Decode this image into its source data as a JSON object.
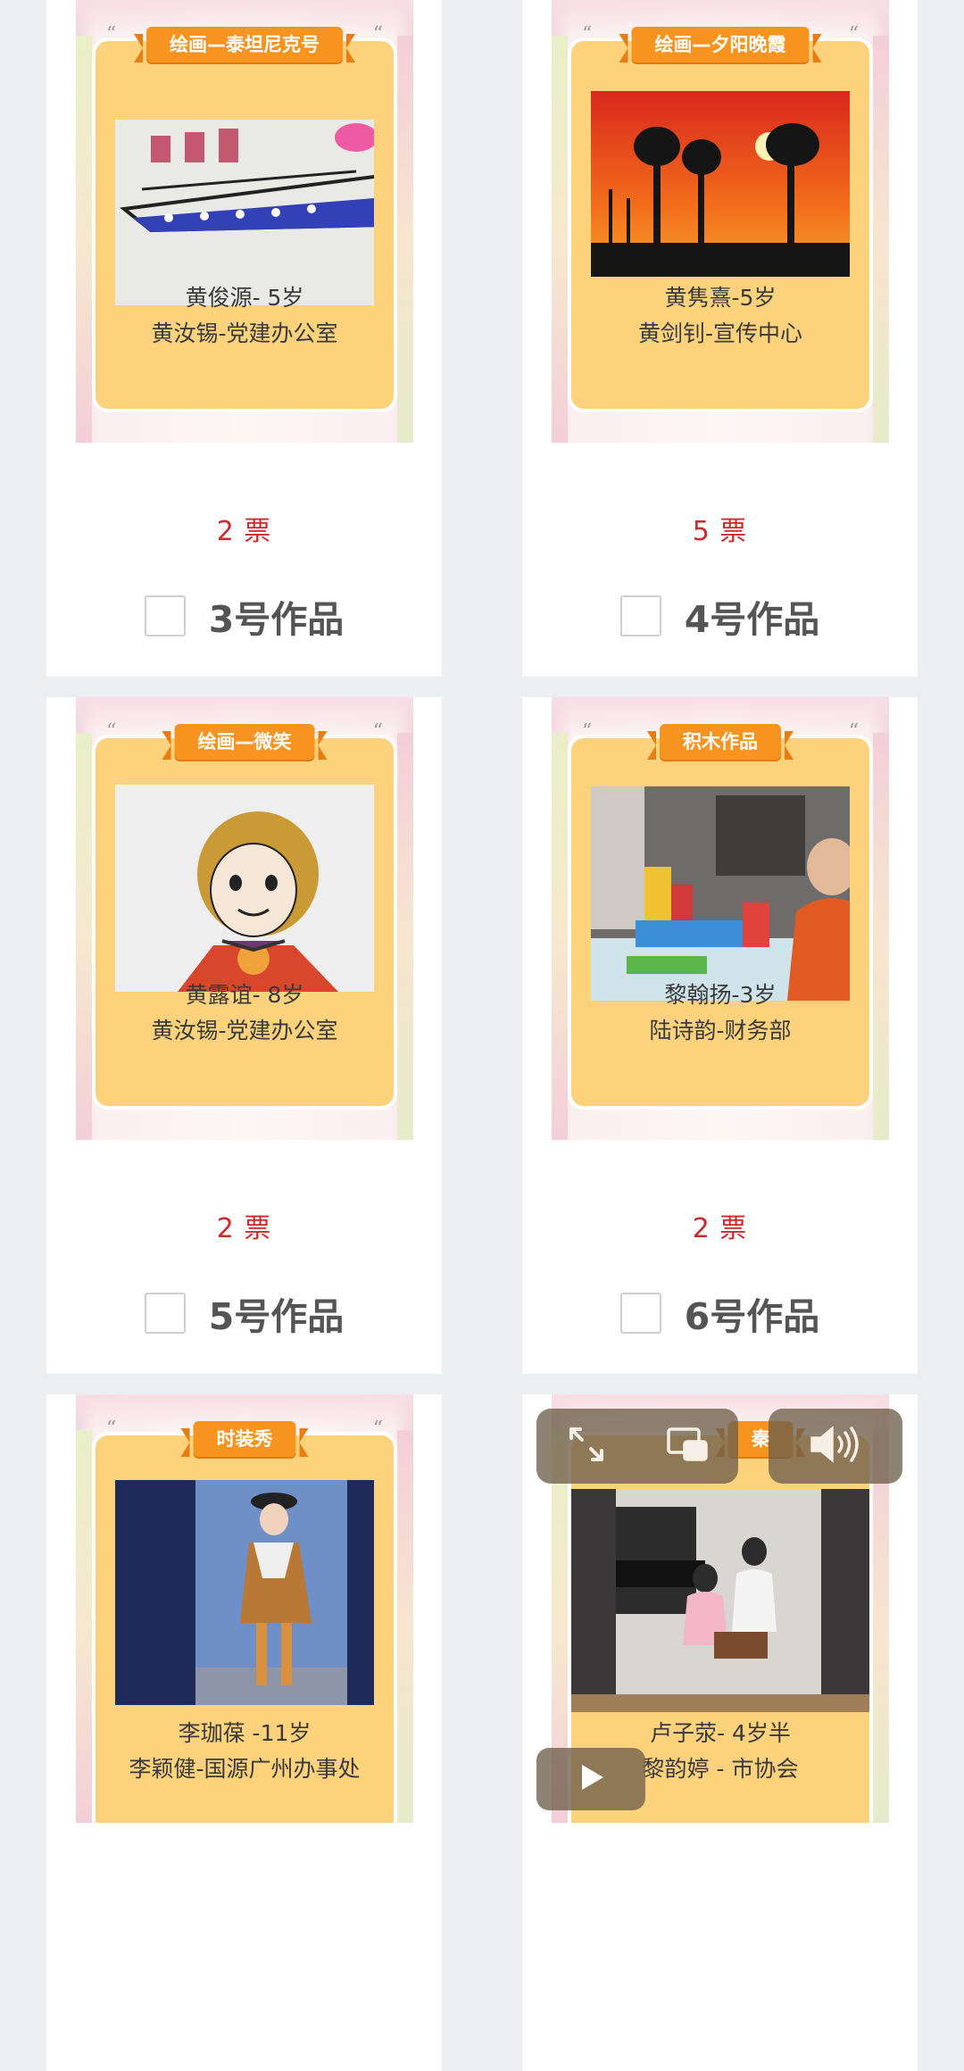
{
  "cards": [
    {
      "ribbon": "绘画—泰坦尼克号",
      "child": "黄俊源- 5岁",
      "parent": "黄汝锡-党建办公室",
      "votes": "2 票",
      "work_label": "3号作品",
      "photo": "ship-drawing"
    },
    {
      "ribbon": "绘画—夕阳晚霞",
      "child": "黄隽熹-5岁",
      "parent": "黄剑钊-宣传中心",
      "votes": "5 票",
      "work_label": "4号作品",
      "photo": "sunset-painting"
    },
    {
      "ribbon": "绘画—微笑",
      "child": "黄露谊- 8岁",
      "parent": "黄汝锡-党建办公室",
      "votes": "2 票",
      "work_label": "5号作品",
      "photo": "girl-drawing"
    },
    {
      "ribbon": "积木作品",
      "child": "黎翰扬-3岁",
      "parent": "陆诗韵-财务部",
      "votes": "2 票",
      "work_label": "6号作品",
      "photo": "building-blocks-photo"
    },
    {
      "ribbon": "时装秀",
      "child": "李珈葆 -11岁",
      "parent": "李颖健-国源广州办事处",
      "photo": "fashion-show-photo"
    },
    {
      "ribbon": "秦",
      "child": "卢子荥- 4岁半",
      "parent": "黎韵婷 - 市协会",
      "photo": "piano-video"
    }
  ],
  "video_controls": {
    "icons": [
      "expand-icon",
      "picture-in-picture-icon",
      "volume-icon",
      "play-icon"
    ]
  },
  "colors": {
    "frame": "#fcd27d",
    "ribbon": "#f7931f",
    "votes": "#cc2b2b",
    "background": "#eceef1"
  }
}
